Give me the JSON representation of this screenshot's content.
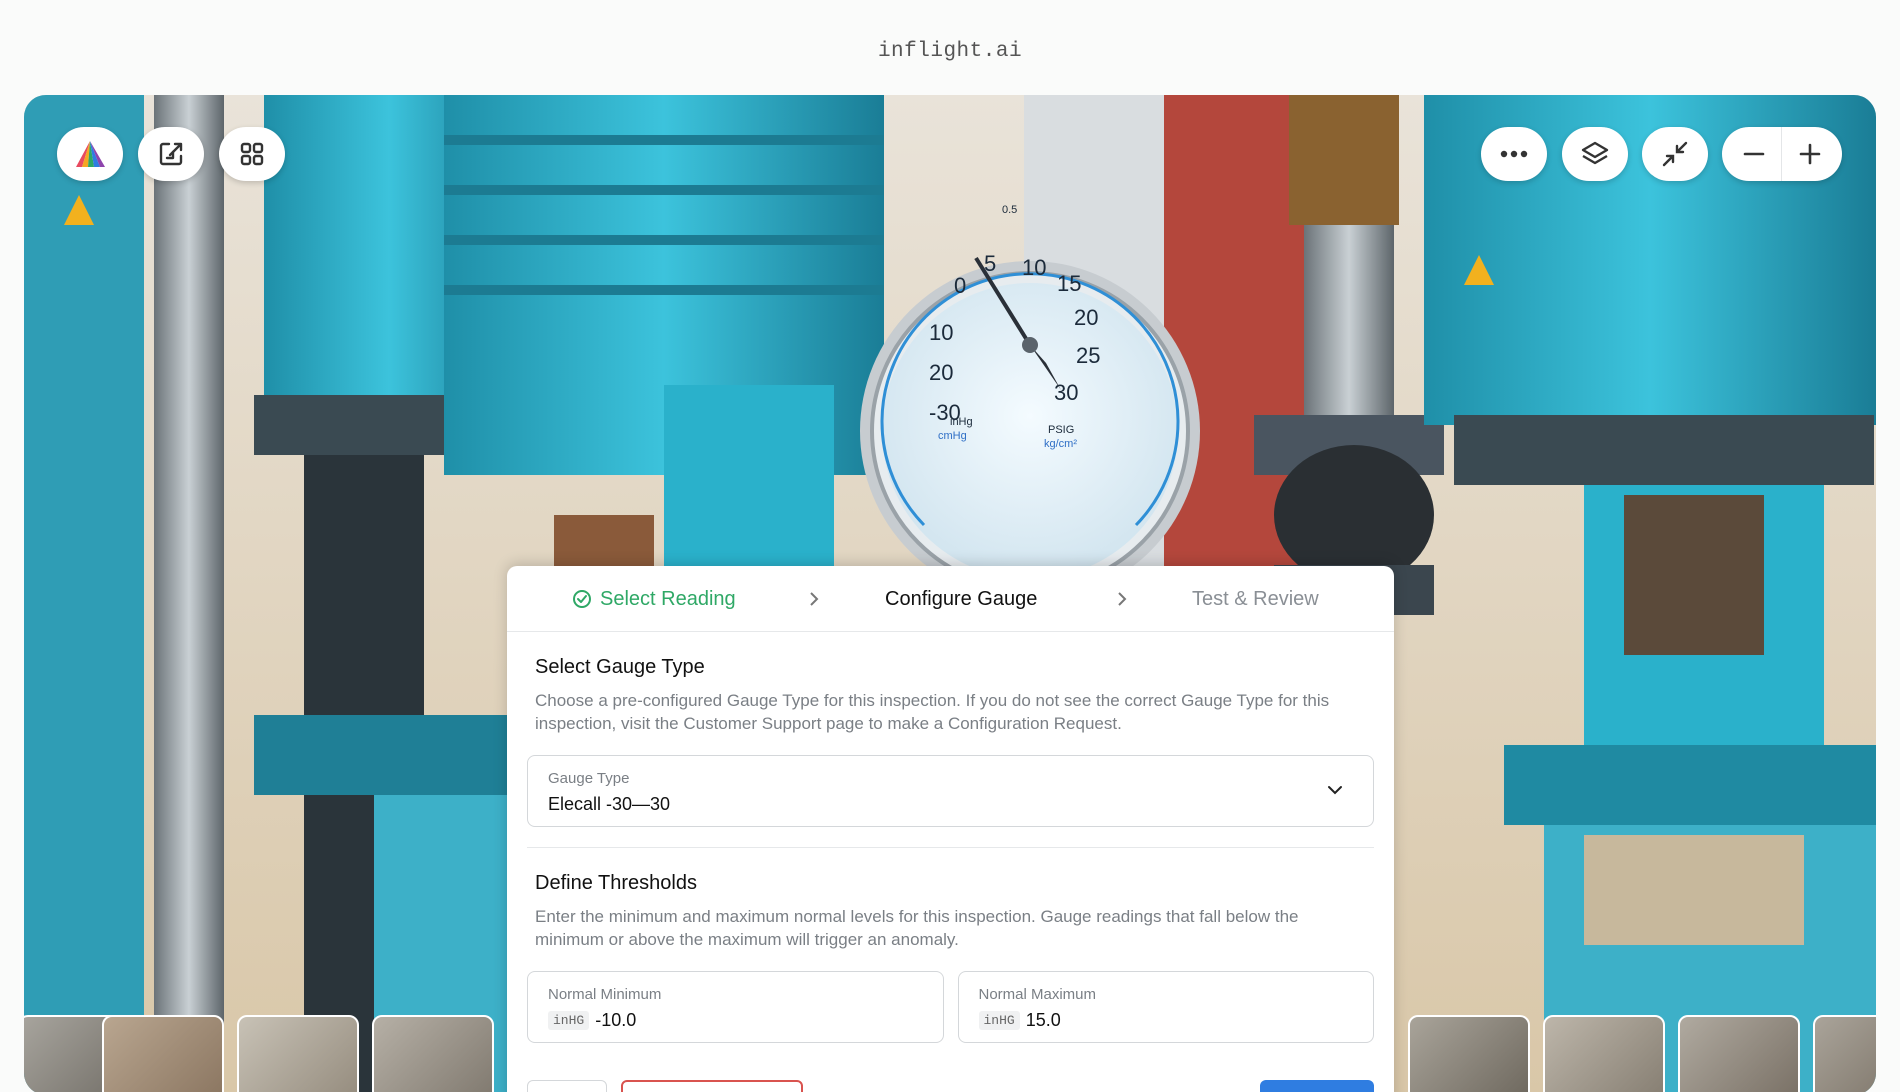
{
  "site": {
    "title": "inflight.ai"
  },
  "toolbar": {
    "left": [
      {
        "name": "logo",
        "icon": "inflight-logo-icon"
      },
      {
        "name": "exit",
        "icon": "exit-icon"
      },
      {
        "name": "grid",
        "icon": "grid-icon"
      }
    ],
    "right": [
      {
        "name": "more",
        "icon": "more-icon"
      },
      {
        "name": "layers",
        "icon": "layers-icon"
      },
      {
        "name": "minimize",
        "icon": "minimize-icon"
      },
      {
        "name": "zoom",
        "icons": [
          "zoom-out-icon",
          "zoom-in-icon"
        ]
      }
    ]
  },
  "steps": [
    {
      "label": "Select Reading",
      "status": "complete",
      "color": "#2fa866"
    },
    {
      "label": "Configure Gauge",
      "status": "active"
    },
    {
      "label": "Test & Review",
      "status": "upcoming"
    }
  ],
  "gauge_section": {
    "title": "Select Gauge Type",
    "description": "Choose a pre-configured Gauge Type for this inspection. If you do not see the correct Gauge Type for this inspection, visit the Customer Support page to make a Configuration Request.",
    "field_label": "Gauge Type",
    "field_value": "Elecall -30—30"
  },
  "threshold_section": {
    "title": "Define Thresholds",
    "description": "Enter the minimum and maximum normal levels for this inspection. Gauge readings that fall below the minimum or above the maximum will trigger an anomaly.",
    "min": {
      "label": "Normal Minimum",
      "unit": "inHG",
      "value": "-10.0"
    },
    "max": {
      "label": "Normal Maximum",
      "unit": "inHG",
      "value": "15.0"
    }
  },
  "gauge_image": {
    "left_scale": [
      "0",
      "10",
      "20",
      "-30"
    ],
    "right_scale": [
      "5",
      "10",
      "15",
      "20",
      "25",
      "30"
    ],
    "top_label": "0.5",
    "unit_left": "inHg",
    "unit_left_sub": "cmHg",
    "unit_right": "PSIG",
    "unit_right_sub": "kg/cm²"
  },
  "colors": {
    "accent": "#2fa866",
    "primary": "#2f7de1",
    "danger": "#d9534f"
  }
}
